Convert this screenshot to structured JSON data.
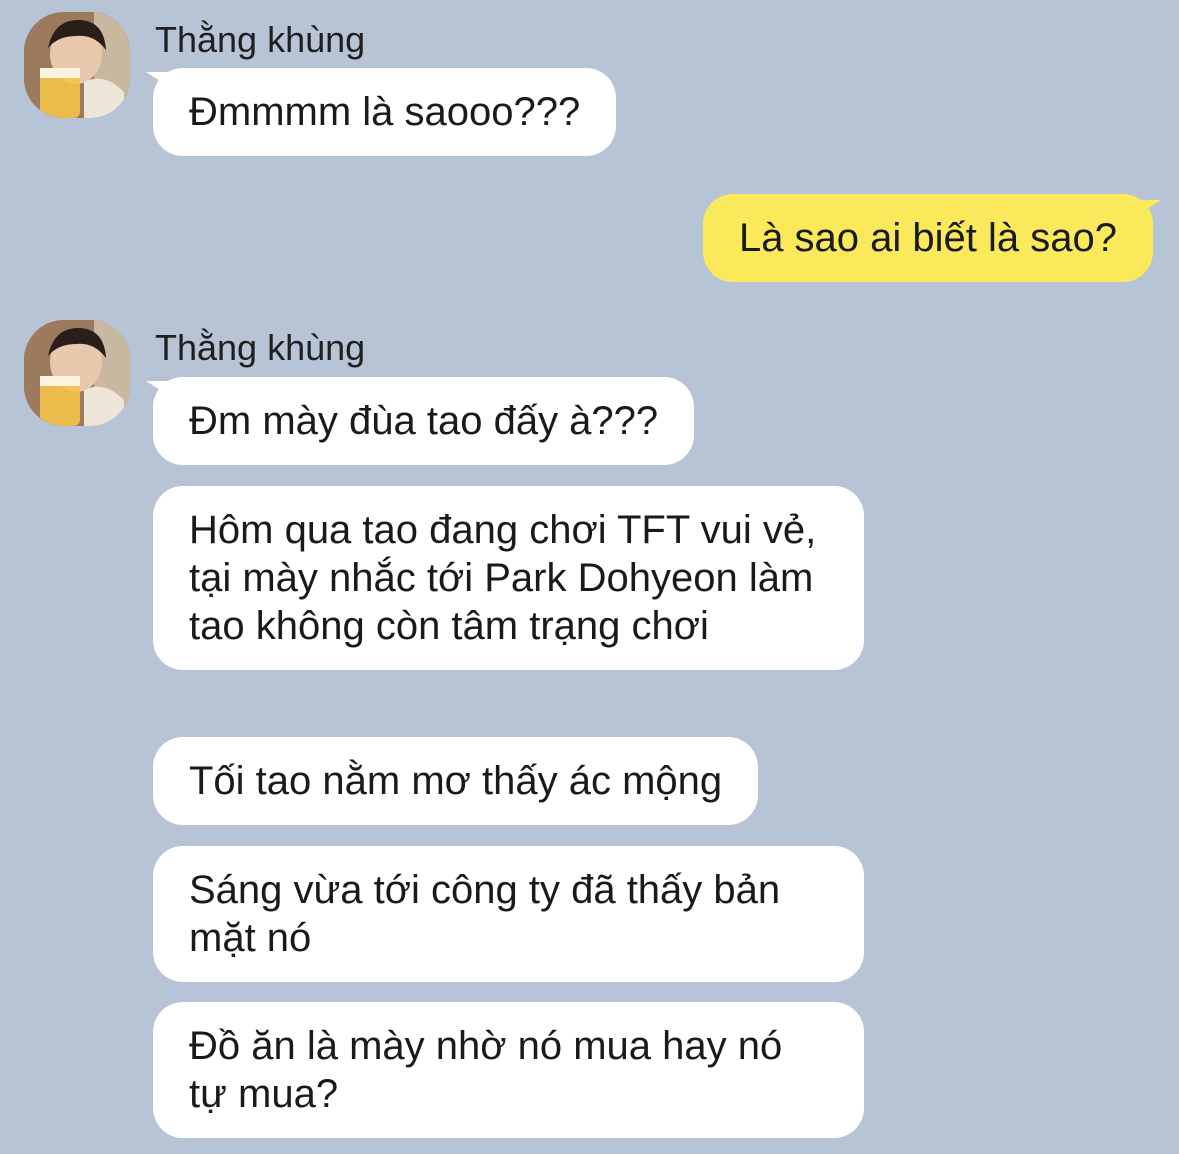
{
  "chat": {
    "messages": [
      {
        "direction": "incoming",
        "sender": "Thằng khùng",
        "avatar_icon": "profile-photo-icon",
        "texts": [
          "Đmmmm là saooo???"
        ]
      },
      {
        "direction": "outgoing",
        "texts": [
          "Là sao ai biết là sao?"
        ]
      },
      {
        "direction": "incoming",
        "sender": "Thằng khùng",
        "avatar_icon": "profile-photo-icon",
        "texts": [
          "Đm mày đùa tao đấy à???",
          "Hôm qua tao đang chơi TFT vui vẻ, tại mày nhắc tới Park Dohyeon làm tao không còn tâm trạng chơi",
          "Tối tao nằm mơ thấy ác mộng",
          "Sáng vừa tới công ty đã thấy bản mặt nó",
          "Đồ ăn là mày nhờ nó mua hay nó tự mua?"
        ]
      }
    ]
  },
  "colors": {
    "background": "#b7c4d6",
    "incoming_bubble": "#ffffff",
    "outgoing_bubble": "#fbe95c",
    "text": "#1a1a1a"
  }
}
